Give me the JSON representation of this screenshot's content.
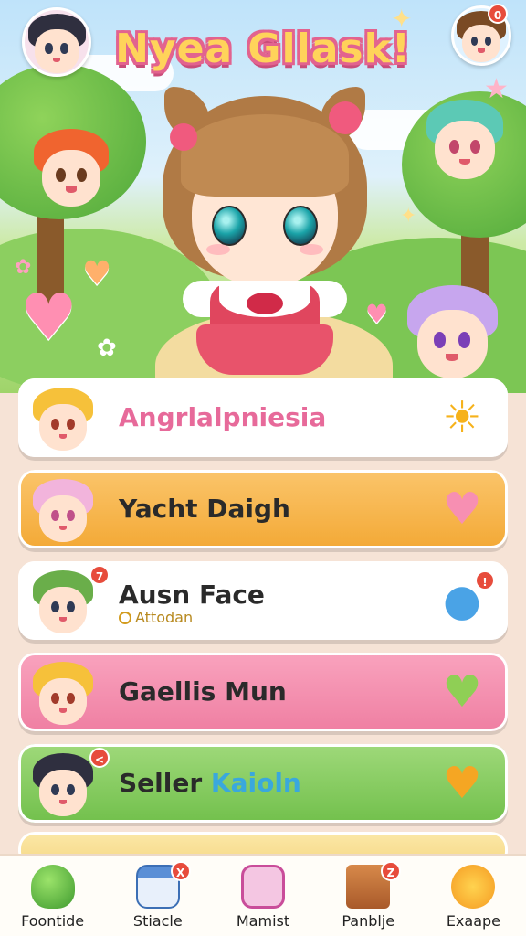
{
  "header": {
    "title": "Nyea Gllask!",
    "avatar_badge": "0"
  },
  "hero": {
    "character": "main-character"
  },
  "list": [
    {
      "label": "Angrlalpniesia",
      "action_icon": "sun-icon",
      "color": "#ffffff"
    },
    {
      "label": "Yacht Daigh",
      "action_icon": "heart-icon",
      "color": "#f3a936"
    },
    {
      "label": "Ausn Face",
      "sub": "Attodan",
      "action_icon": "chat-bubble-icon",
      "badge": "!",
      "color": "#ffffff"
    },
    {
      "label": "Gaellis Mun",
      "action_icon": "heart-icon",
      "color": "#ef7fa2"
    },
    {
      "label_a": "Seller",
      "label_b": "Kaioln",
      "action_icon": "heart-icon",
      "color": "#72c04c"
    }
  ],
  "avatar_badges": {
    "row3": "7",
    "row5": "<"
  },
  "nav": [
    {
      "label": "Foontide",
      "icon": "slime-icon"
    },
    {
      "label": "Stiacle",
      "icon": "calendar-icon",
      "badge": "X"
    },
    {
      "label": "Mamist",
      "icon": "photo-frame-icon"
    },
    {
      "label": "Panblje",
      "icon": "box-icon",
      "badge": "Z"
    },
    {
      "label": "Exaape",
      "icon": "cat-icon"
    }
  ]
}
